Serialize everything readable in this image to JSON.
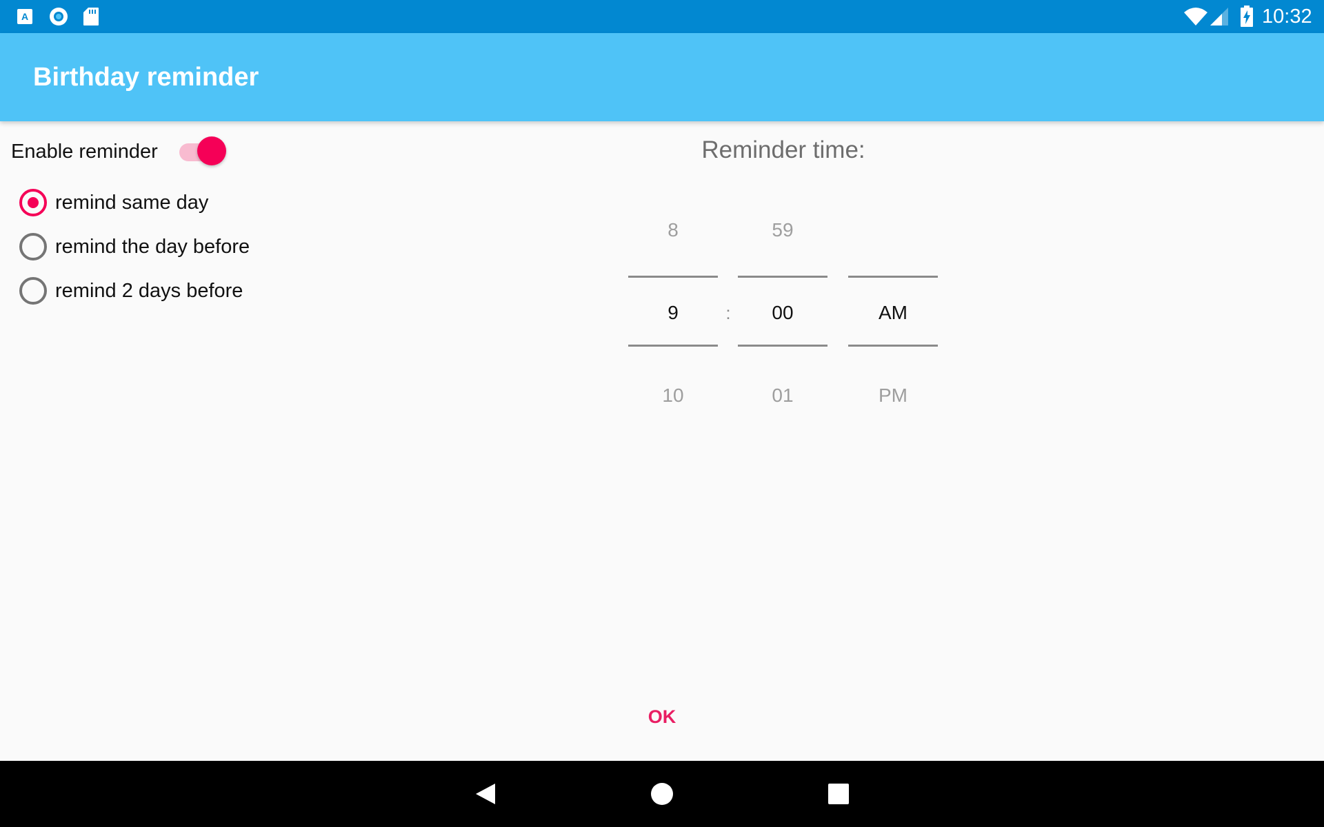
{
  "status_bar": {
    "time": "10:32",
    "icons": [
      "app-a-icon",
      "sync-circle-icon",
      "sd-card-icon",
      "wifi-icon",
      "signal-icon",
      "battery-charging-icon"
    ]
  },
  "app_bar": {
    "title": "Birthday reminder"
  },
  "reminder": {
    "enable_label": "Enable reminder",
    "enabled": true,
    "options": [
      {
        "label": "remind same day",
        "checked": true
      },
      {
        "label": "remind the day before",
        "checked": false
      },
      {
        "label": "remind 2 days before",
        "checked": false
      }
    ]
  },
  "time_picker": {
    "title": "Reminder time:",
    "separator": ":",
    "hour": {
      "prev": "8",
      "current": "9",
      "next": "10"
    },
    "minute": {
      "prev": "59",
      "current": "00",
      "next": "01"
    },
    "ampm": {
      "prev": "",
      "current": "AM",
      "next": "PM"
    }
  },
  "actions": {
    "ok_label": "OK"
  },
  "colors": {
    "status_bar": "#0288d1",
    "app_bar": "#4fc3f7",
    "accent": "#f50057",
    "ok_text": "#e91e63",
    "background": "#fafafa"
  },
  "nav_bar": {
    "icons": [
      "back-icon",
      "home-icon",
      "recents-icon"
    ]
  }
}
